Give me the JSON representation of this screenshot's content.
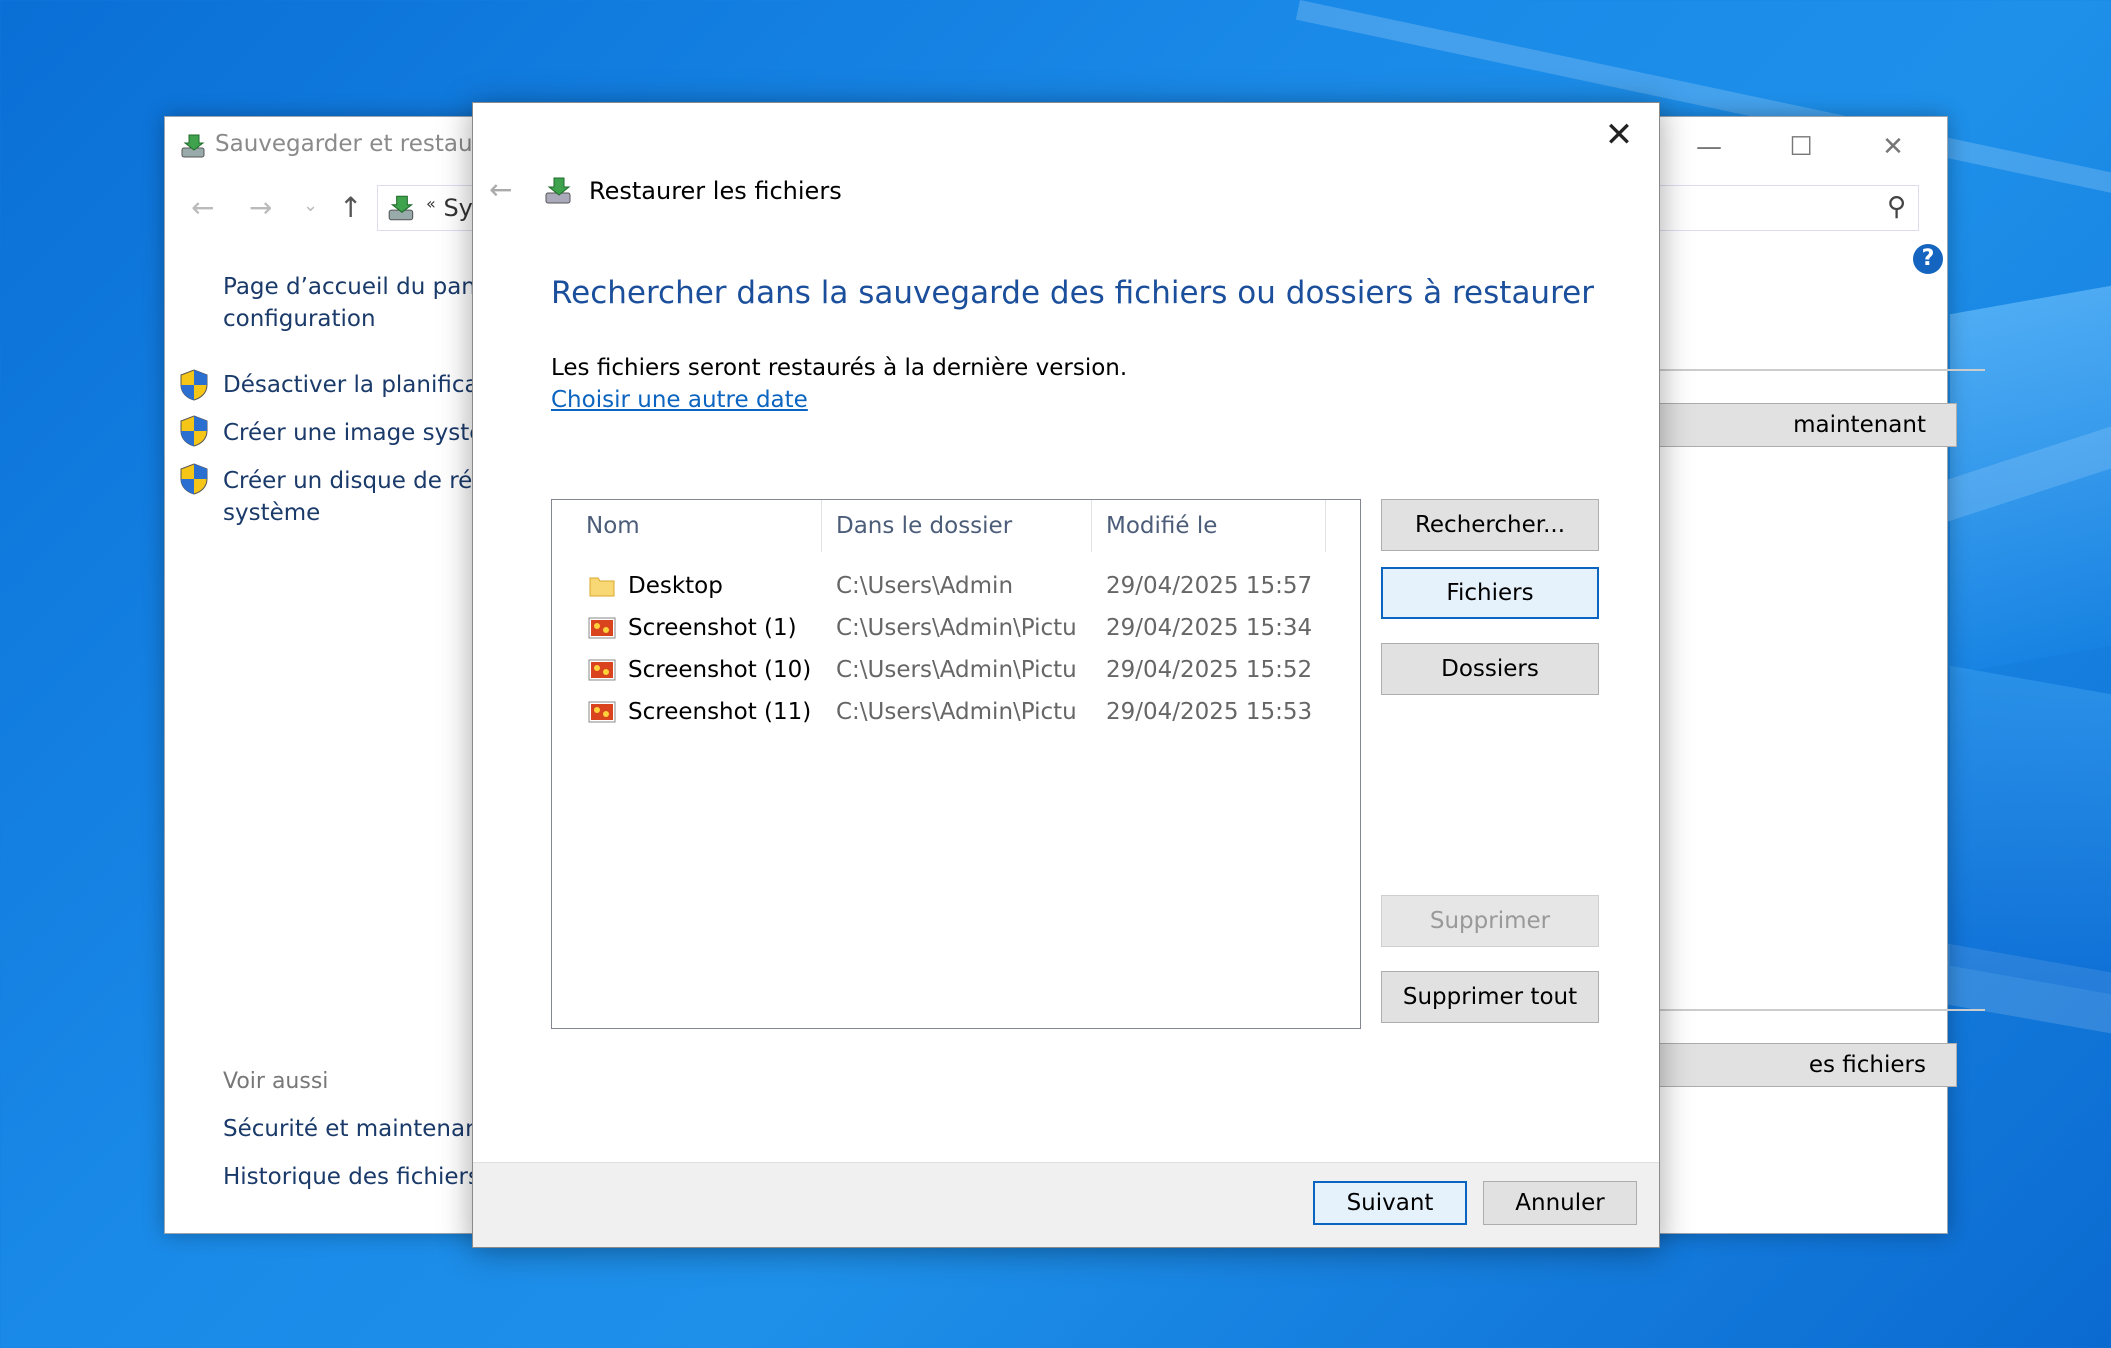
{
  "background_window": {
    "title": "Sauvegarder et restaurer",
    "address_text": "Sy",
    "address_prefix": "«",
    "left_pane": {
      "home_link_line1": "Page d’accueil du panne",
      "home_link_line2": "configuration",
      "tasks": [
        {
          "label": "Désactiver la planificatio"
        },
        {
          "label": "Créer une image systèm"
        },
        {
          "label": "Créer un disque de répa",
          "label2": "système"
        }
      ],
      "see_also_label": "Voir aussi",
      "see_also_links": [
        "Sécurité et maintenance",
        "Historique des fichiers"
      ]
    },
    "right_buttons": [
      "maintenant",
      "es fichiers"
    ]
  },
  "dialog": {
    "title": "Restaurer les fichiers",
    "heading": "Rechercher dans la sauvegarde des fichiers ou dossiers à restaurer",
    "info": "Les fichiers seront restaurés à la dernière version.",
    "date_link": "Choisir une autre date",
    "columns": [
      "Nom",
      "Dans le dossier",
      "Modifié le"
    ],
    "files": [
      {
        "name": "Desktop",
        "folder": "C:\\Users\\Admin",
        "modified": "29/04/2025 15:57",
        "icon": "folder-icon"
      },
      {
        "name": "Screenshot (1)",
        "folder": "C:\\Users\\Admin\\Pictu...",
        "modified": "29/04/2025 15:34",
        "icon": "image-file-icon"
      },
      {
        "name": "Screenshot (10)",
        "folder": "C:\\Users\\Admin\\Pictu...",
        "modified": "29/04/2025 15:52",
        "icon": "image-file-icon"
      },
      {
        "name": "Screenshot (11)",
        "folder": "C:\\Users\\Admin\\Pictu...",
        "modified": "29/04/2025 15:53",
        "icon": "image-file-icon"
      }
    ],
    "side_buttons": {
      "search": "Rechercher...",
      "files": "Fichiers",
      "folders": "Dossiers",
      "remove": "Supprimer",
      "remove_all": "Supprimer tout"
    },
    "footer": {
      "next": "Suivant",
      "cancel": "Annuler"
    }
  },
  "colors": {
    "heading": "#1b4f9c",
    "link": "#0b64c0",
    "desktop": "#1a8ae8"
  }
}
